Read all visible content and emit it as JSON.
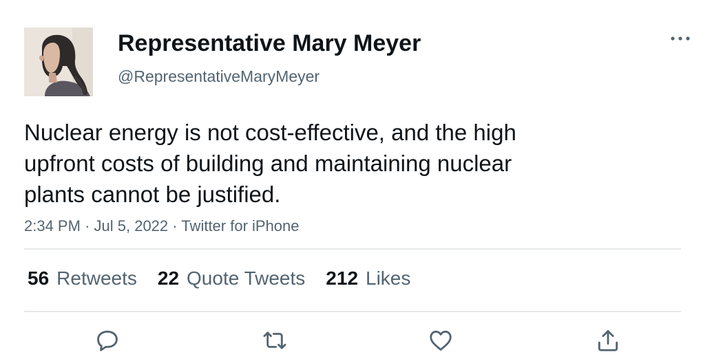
{
  "tweet": {
    "author": {
      "name": "Representative Mary Meyer",
      "handle": "@RepresentativeMaryMeyer",
      "avatar_icon": "profile-photo"
    },
    "text_lines": [
      "Nuclear energy is not cost-effective, and the high",
      "upfront costs of building and maintaining nuclear",
      "plants cannot be justified."
    ],
    "time": "2:34 PM",
    "separator": "·",
    "date": "Jul 5, 2022",
    "source": "Twitter for iPhone",
    "stats": {
      "retweets": {
        "count": "56",
        "label": "Retweets"
      },
      "quote_tweets": {
        "count": "22",
        "label": "Quote Tweets"
      },
      "likes": {
        "count": "212",
        "label": "Likes"
      }
    },
    "actions": {
      "reply_icon": "reply-icon",
      "retweet_icon": "retweet-icon",
      "like_icon": "heart-icon",
      "share_icon": "share-icon",
      "more_icon": "more-options-icon"
    }
  },
  "colors": {
    "text_primary": "#0f1419",
    "text_secondary": "#536471",
    "divider": "#e6e9eb",
    "icon": "#536471"
  }
}
